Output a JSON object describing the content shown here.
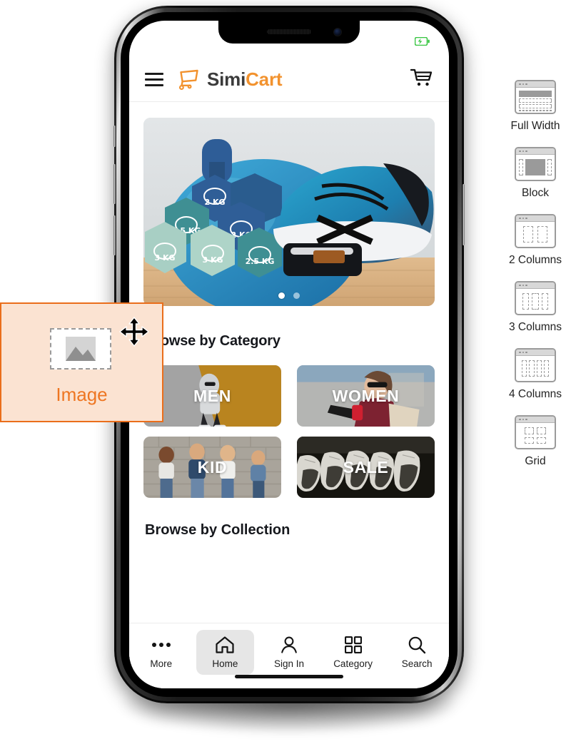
{
  "phone": {
    "status_bar": {
      "battery_icon": "battery-charging-icon",
      "battery_color": "#35c53f"
    },
    "home_indicator": "home-indicator"
  },
  "app": {
    "header": {
      "menu_icon": "hamburger-menu-icon",
      "logo": {
        "icon": "shopping-cart-logo-icon",
        "text_primary": "Simi",
        "text_accent": "Cart",
        "primary_color": "#3b3b3b",
        "accent_color": "#F2922E"
      },
      "cart_icon": "shopping-cart-icon"
    },
    "hero": {
      "alt": "fitness dumbbells exercise ball and running shoe",
      "dots": [
        {
          "active": true
        },
        {
          "active": false
        }
      ]
    },
    "sections": [
      {
        "title": "Browse by Category"
      },
      {
        "title": "Browse by Collection"
      }
    ],
    "categories": [
      {
        "label": "MEN",
        "image": "man-sitting-against-yellow-wall"
      },
      {
        "label": "WOMEN",
        "image": "woman-with-sunglasses-and-phone"
      },
      {
        "label": "KID",
        "image": "four-kids-against-brick-wall"
      },
      {
        "label": "SALE",
        "image": "row-of-sneakers-dark"
      }
    ],
    "bottom_nav": [
      {
        "label": "More",
        "icon": "ellipsis-icon",
        "active": false
      },
      {
        "label": "Home",
        "icon": "home-icon",
        "active": true
      },
      {
        "label": "Sign In",
        "icon": "user-icon",
        "active": false
      },
      {
        "label": "Category",
        "icon": "grid-squares-icon",
        "active": false
      },
      {
        "label": "Search",
        "icon": "search-icon",
        "active": false
      }
    ]
  },
  "image_card": {
    "label": "Image",
    "placeholder_icon": "image-placeholder-icon",
    "move_icon": "move-arrows-icon",
    "background_color": "#FBE3D2",
    "border_color": "#EA6E1B",
    "text_color": "#EE7622"
  },
  "layout_panel": {
    "items": [
      {
        "label": "Full Width",
        "icon": "layout-full-width-icon"
      },
      {
        "label": "Block",
        "icon": "layout-block-icon"
      },
      {
        "label": "2 Columns",
        "icon": "layout-2-columns-icon"
      },
      {
        "label": "3 Columns",
        "icon": "layout-3-columns-icon"
      },
      {
        "label": "4 Columns",
        "icon": "layout-4-columns-icon"
      },
      {
        "label": "Grid",
        "icon": "layout-grid-icon"
      }
    ]
  }
}
